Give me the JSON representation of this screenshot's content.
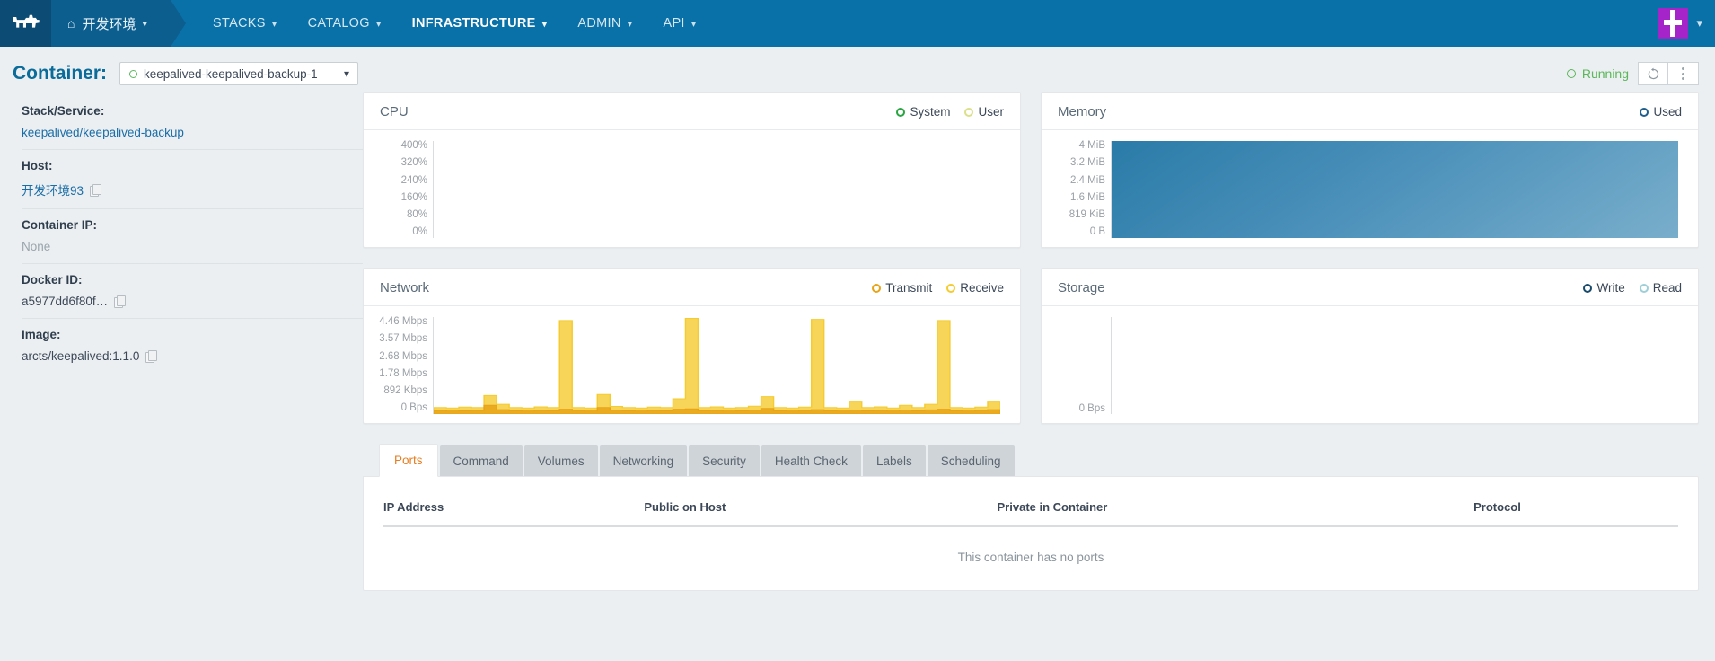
{
  "topnav": {
    "logo_icon": "rancher-cow-logo",
    "environment": {
      "label": "开发环境",
      "home_icon": "home-icon",
      "caret_icon": "chevron-down-icon"
    },
    "items": [
      {
        "label": "STACKS",
        "active": false
      },
      {
        "label": "CATALOG",
        "active": false
      },
      {
        "label": "INFRASTRUCTURE",
        "active": true
      },
      {
        "label": "ADMIN",
        "active": false
      },
      {
        "label": "API",
        "active": false
      }
    ],
    "avatar_icon": "user-avatar",
    "avatar_color": "#a524c9",
    "avatar_caret_icon": "chevron-down-icon",
    "bar_color": "#0a71a8"
  },
  "header": {
    "title": "Container:",
    "selected_container": "keepalived-keepalived-backup-1",
    "select_caret_icon": "chevron-down-icon",
    "status": "Running",
    "status_color": "#5bb75b",
    "restart_icon": "restart-icon",
    "menu_icon": "vertical-dots-icon"
  },
  "sidebar": {
    "rows": [
      {
        "label": "Stack/Service:",
        "value": "keepalived/keepalived-backup",
        "is_link": true,
        "copy": false
      },
      {
        "label": "Host:",
        "value": "开发环境93",
        "is_link": true,
        "copy": true
      },
      {
        "label": "Container IP:",
        "value": "None",
        "is_link": false,
        "copy": false,
        "muted": true
      },
      {
        "label": "Docker ID:",
        "value": "a5977dd6f80f…",
        "is_link": false,
        "copy": true
      },
      {
        "label": "Image:",
        "value": "arcts/keepalived:1.1.0",
        "is_link": false,
        "copy": true
      }
    ]
  },
  "charts": [
    {
      "title": "CPU",
      "legend": [
        {
          "label": "System",
          "color": "#27a53f"
        },
        {
          "label": "User",
          "color": "#dbe08a"
        }
      ],
      "yticks": [
        "400%",
        "320%",
        "240%",
        "160%",
        "80%",
        "0%"
      ]
    },
    {
      "title": "Memory",
      "legend": [
        {
          "label": "Used",
          "color": "#1f5e8c"
        }
      ],
      "yticks": [
        "4 MiB",
        "3.2 MiB",
        "2.4 MiB",
        "1.6 MiB",
        "819 KiB",
        "0 B"
      ]
    },
    {
      "title": "Network",
      "legend": [
        {
          "label": "Transmit",
          "color": "#e8a317"
        },
        {
          "label": "Receive",
          "color": "#f5cb2e"
        }
      ],
      "yticks": [
        "4.46 Mbps",
        "3.57 Mbps",
        "2.68 Mbps",
        "1.78 Mbps",
        "892 Kbps",
        "0 Bps"
      ]
    },
    {
      "title": "Storage",
      "legend": [
        {
          "label": "Write",
          "color": "#17496b"
        },
        {
          "label": "Read",
          "color": "#9ecfd8"
        }
      ],
      "yticks": [
        "0 Bps"
      ]
    }
  ],
  "chart_data": [
    {
      "type": "area",
      "title": "CPU",
      "ylabel": "",
      "ytick_labels": [
        "400%",
        "320%",
        "240%",
        "160%",
        "80%",
        "0%"
      ],
      "ylim": [
        0,
        400
      ],
      "grid": false,
      "legend_position": "top-right",
      "series": [
        {
          "name": "System",
          "color": "#27a53f",
          "values": []
        },
        {
          "name": "User",
          "color": "#dbe08a",
          "values": []
        }
      ]
    },
    {
      "type": "area",
      "title": "Memory",
      "ylabel": "",
      "ytick_labels": [
        "4 MiB",
        "3.2 MiB",
        "2.4 MiB",
        "1.6 MiB",
        "819 KiB",
        "0 B"
      ],
      "ylim": [
        0,
        4194304
      ],
      "grid": false,
      "legend_position": "top-right",
      "series": [
        {
          "name": "Used",
          "color": "#3c83ad",
          "values": [
            4.0,
            4.0,
            4.0,
            4.0,
            4.0,
            4.0,
            4.0,
            4.0,
            4.0,
            4.0,
            4.0,
            4.0,
            4.0,
            4.0,
            4.0,
            4.0,
            4.0,
            4.0,
            4.0,
            4.0,
            4.0,
            4.0,
            4.0,
            4.0,
            4.0,
            4.0,
            4.0,
            4.0,
            4.0,
            4.0
          ],
          "unit": "MiB"
        }
      ]
    },
    {
      "type": "area",
      "title": "Network",
      "ylabel": "",
      "ytick_labels": [
        "4.46 Mbps",
        "3.57 Mbps",
        "2.68 Mbps",
        "1.78 Mbps",
        "892 Kbps",
        "0 Bps"
      ],
      "ylim": [
        0,
        4.46
      ],
      "unit": "Mbps",
      "grid": false,
      "legend_position": "top-right",
      "series": [
        {
          "name": "Receive",
          "color": "#f5cb2e",
          "values": [
            0.3,
            0.28,
            0.32,
            0.3,
            0.85,
            0.45,
            0.3,
            0.28,
            0.33,
            0.3,
            4.3,
            0.3,
            0.28,
            0.9,
            0.35,
            0.3,
            0.28,
            0.32,
            0.3,
            0.7,
            4.4,
            0.3,
            0.33,
            0.28,
            0.3,
            0.36,
            0.8,
            0.3,
            0.28,
            0.32,
            4.35,
            0.3,
            0.28,
            0.55,
            0.3,
            0.33,
            0.28,
            0.4,
            0.3,
            0.45,
            4.3,
            0.3,
            0.28,
            0.32,
            0.55
          ]
        },
        {
          "name": "Transmit",
          "color": "#e8a317",
          "values": [
            0.16,
            0.14,
            0.15,
            0.16,
            0.4,
            0.2,
            0.15,
            0.14,
            0.16,
            0.15,
            0.22,
            0.16,
            0.14,
            0.3,
            0.17,
            0.15,
            0.14,
            0.16,
            0.15,
            0.22,
            0.24,
            0.15,
            0.16,
            0.14,
            0.15,
            0.17,
            0.26,
            0.15,
            0.14,
            0.16,
            0.2,
            0.15,
            0.14,
            0.18,
            0.15,
            0.16,
            0.14,
            0.18,
            0.15,
            0.19,
            0.22,
            0.15,
            0.14,
            0.16,
            0.2
          ]
        }
      ]
    },
    {
      "type": "area",
      "title": "Storage",
      "ylabel": "",
      "ytick_labels": [
        "0 Bps"
      ],
      "ylim": [
        0,
        0
      ],
      "grid": false,
      "legend_position": "top-right",
      "series": [
        {
          "name": "Write",
          "color": "#17496b",
          "values": []
        },
        {
          "name": "Read",
          "color": "#9ecfd8",
          "values": []
        }
      ]
    }
  ],
  "tabs": [
    {
      "label": "Ports",
      "active": true
    },
    {
      "label": "Command",
      "active": false
    },
    {
      "label": "Volumes",
      "active": false
    },
    {
      "label": "Networking",
      "active": false
    },
    {
      "label": "Security",
      "active": false
    },
    {
      "label": "Health Check",
      "active": false
    },
    {
      "label": "Labels",
      "active": false
    },
    {
      "label": "Scheduling",
      "active": false
    }
  ],
  "ports_table": {
    "columns": [
      "IP Address",
      "Public on Host",
      "Private in Container",
      "Protocol"
    ],
    "rows": [],
    "empty_message": "This container has no ports"
  }
}
